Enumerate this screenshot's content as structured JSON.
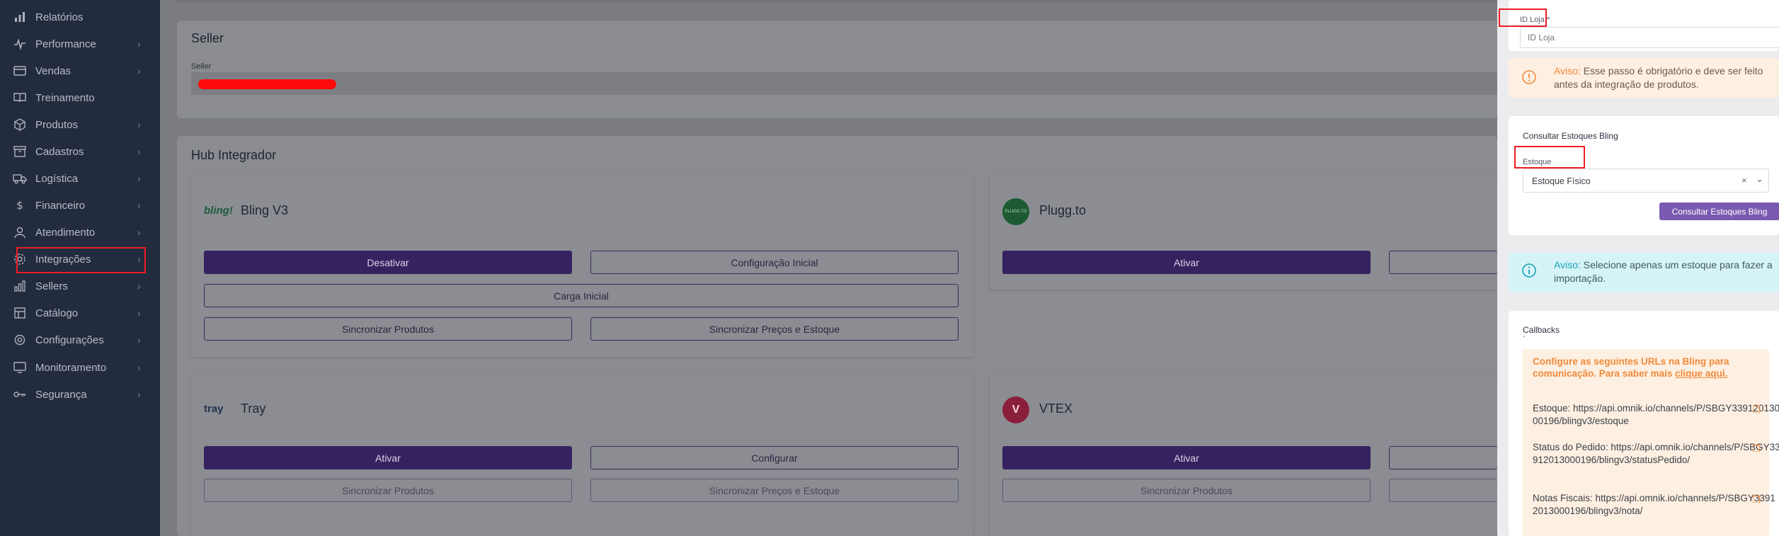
{
  "sidebar": {
    "items": [
      {
        "label": "Relatórios",
        "icon": "bar-chart-icon",
        "chevron": false
      },
      {
        "label": "Performance",
        "icon": "pulse-icon",
        "chevron": true
      },
      {
        "label": "Vendas",
        "icon": "credit-card-icon",
        "chevron": true
      },
      {
        "label": "Treinamento",
        "icon": "book-icon",
        "chevron": false
      },
      {
        "label": "Produtos",
        "icon": "box-icon",
        "chevron": true
      },
      {
        "label": "Cadastros",
        "icon": "archive-icon",
        "chevron": true
      },
      {
        "label": "Logística",
        "icon": "truck-icon",
        "chevron": true
      },
      {
        "label": "Financeiro",
        "icon": "dollar-icon",
        "chevron": true
      },
      {
        "label": "Atendimento",
        "icon": "user-headset-icon",
        "chevron": true
      },
      {
        "label": "Integrações",
        "icon": "gear-icon",
        "chevron": true
      },
      {
        "label": "Sellers",
        "icon": "bar-chart-icon",
        "chevron": true
      },
      {
        "label": "Catálogo",
        "icon": "catalog-icon",
        "chevron": true
      },
      {
        "label": "Configurações",
        "icon": "settings-icon",
        "chevron": true
      },
      {
        "label": "Monitoramento",
        "icon": "monitor-icon",
        "chevron": true
      },
      {
        "label": "Segurança",
        "icon": "key-icon",
        "chevron": true
      }
    ]
  },
  "seller_card": {
    "title": "Seller",
    "field_label": "Seller"
  },
  "hub": {
    "title": "Hub Integrador",
    "bling": {
      "logo_text": "bling!",
      "name": "Bling V3",
      "btn_desativar": "Desativar",
      "btn_config": "Configuração Inicial",
      "btn_carga": "Carga Inicial",
      "btn_sync_prod": "Sincronizar Produtos",
      "btn_sync_precos": "Sincronizar Preços e Estoque"
    },
    "plugg": {
      "logo_text": "PLUGG.TO",
      "name": "Plugg.to",
      "btn_ativar": "Ativar"
    },
    "tray": {
      "logo_text": "tray",
      "name": "Tray",
      "btn_ativar": "Ativar",
      "btn_config": "Configurar",
      "btn_sync_prod": "Sincronizar Produtos",
      "btn_sync_precos": "Sincronizar Preços e Estoque"
    },
    "vtex": {
      "logo_text": "V",
      "name": "VTEX",
      "btn_ativar": "Ativar",
      "btn_sync_prod": "Sincronizar Produtos"
    }
  },
  "panel": {
    "id_loja_label": "ID Loja *",
    "id_loja_placeholder": "ID Loja",
    "aviso1_prefix": "Aviso:",
    "aviso1_text": " Esse passo é obrigatório e deve ser feito antes da integração de produtos.",
    "estoques_title": "Consultar Estoques Bling",
    "estoque_label": "Estoque",
    "estoque_value": "Estoque Físico",
    "btn_consultar": "Consultar Estoques Bling",
    "aviso2_prefix": "Aviso:",
    "aviso2_text": " Selecione apenas um estoque para fazer a importação.",
    "callbacks_title": "Callbacks",
    "callbacks_dash": "-",
    "callbacks_msg": "Configure as seguintes URLs na Bling para comunicação. Para saber mais ",
    "callbacks_link": "clique aqui.",
    "urls": [
      {
        "label": "Estoque: https://api.omnik.io/channels/P/SBGY33912013000196/blingv3/estoque"
      },
      {
        "label": "Status do Pedido: https://api.omnik.io/channels/P/SBGY33912013000196/blingv3/statusPedido/"
      },
      {
        "label": "Notas Fiscais: https://api.omnik.io/channels/P/SBGY33912013000196/blingv3/nota/"
      }
    ]
  },
  "colors": {
    "sidebar_bg": "#232b3e",
    "primary": "#372260",
    "warning": "#f08a3a",
    "info": "#17a2b8",
    "highlight": "#ee1c24"
  }
}
